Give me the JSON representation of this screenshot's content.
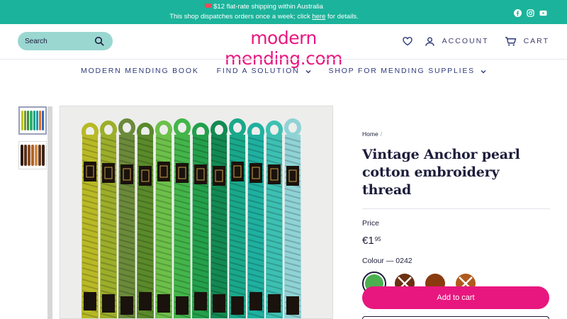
{
  "announcement": {
    "line1": "$12 flat-rate shipping within Australia",
    "line2_prefix": "This shop dispatches orders once a week; click ",
    "line2_link": "here",
    "line2_suffix": " for details.",
    "flag_icon": "australia-flag-icon",
    "social_icons": [
      "facebook-icon",
      "instagram-icon",
      "youtube-icon"
    ]
  },
  "header": {
    "logo": "modern mending.com",
    "search": {
      "placeholder": "Search",
      "value": ""
    },
    "wishlist_icon": "heart-icon",
    "account_label": "ACCOUNT",
    "cart_label": "CART"
  },
  "nav": {
    "items": [
      {
        "label": "MODERN MENDING BOOK",
        "has_dropdown": false
      },
      {
        "label": "FIND A SOLUTION",
        "has_dropdown": true
      },
      {
        "label": "SHOP FOR MENDING SUPPLIES",
        "has_dropdown": true
      }
    ]
  },
  "product": {
    "breadcrumb": [
      "Home"
    ],
    "title": "Vintage Anchor pearl cotton embroidery thread",
    "price_label": "Price",
    "price_main": "€1",
    "price_cents": "95",
    "colour_label": "Colour — 0242",
    "swatches": [
      {
        "color": "#4caf50",
        "selected": true,
        "sold_out": false
      },
      {
        "color": "#6b2f12",
        "selected": false,
        "sold_out": true
      },
      {
        "color": "#8a3a0f",
        "selected": false,
        "sold_out": false
      },
      {
        "color": "#b05a1e",
        "selected": false,
        "sold_out": true
      }
    ],
    "add_to_cart_label": "Add to cart"
  },
  "colors": {
    "brand_pink": "#e8177f",
    "announcement_teal": "#1bb39b",
    "search_bg": "#9ad7d1",
    "nav_text": "#2f3a7a"
  }
}
